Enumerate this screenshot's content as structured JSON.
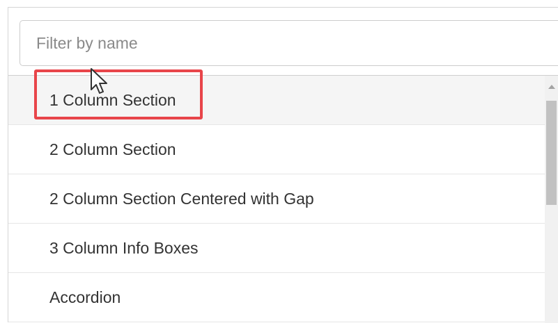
{
  "filter": {
    "placeholder": "Filter by name",
    "value": ""
  },
  "list": {
    "items": [
      {
        "label": "1 Column Section",
        "hovered": true,
        "highlighted": true
      },
      {
        "label": "2 Column Section"
      },
      {
        "label": "2 Column Section Centered with Gap"
      },
      {
        "label": "3 Column Info Boxes"
      },
      {
        "label": "Accordion"
      }
    ]
  },
  "colors": {
    "highlight": "#e8454a",
    "hover_bg": "#f5f5f5",
    "border": "#d5d5d5",
    "text": "#333333",
    "placeholder": "#8a8a8a",
    "scroll_thumb": "#c1c1c1"
  },
  "icons": {
    "cursor": "arrow-cursor-icon",
    "scroll_up": "triangle-up-icon"
  }
}
